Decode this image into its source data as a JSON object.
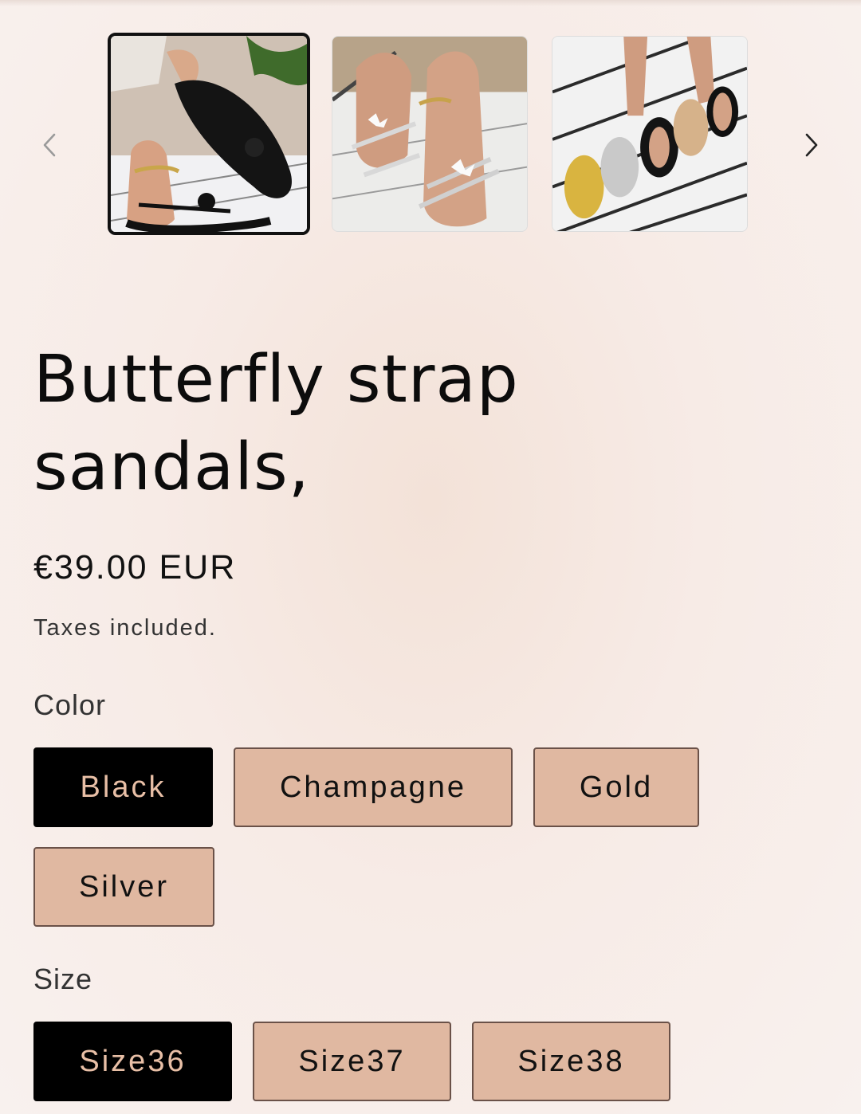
{
  "gallery": {
    "prev_icon": "chevron-left-icon",
    "next_icon": "chevron-right-icon",
    "thumbnails": [
      {
        "name": "black-sandal-thumbnail",
        "selected": true
      },
      {
        "name": "silver-sandal-thumbnail",
        "selected": false
      },
      {
        "name": "assorted-colors-thumbnail",
        "selected": false
      }
    ]
  },
  "product": {
    "title": "Butterfly strap sandals,",
    "price": "€39.00 EUR",
    "taxes_note": "Taxes included."
  },
  "options": {
    "color": {
      "label": "Color",
      "values": [
        "Black",
        "Champagne",
        "Gold",
        "Silver"
      ],
      "selected": "Black"
    },
    "size": {
      "label": "Size",
      "values": [
        "Size36",
        "Size37",
        "Size38"
      ],
      "selected": "Size36"
    }
  },
  "colors": {
    "selected_bg": "#000000",
    "selected_text": "#e8bfa6",
    "pill_bg": "#e0b8a1",
    "pill_border": "#6a5148"
  }
}
